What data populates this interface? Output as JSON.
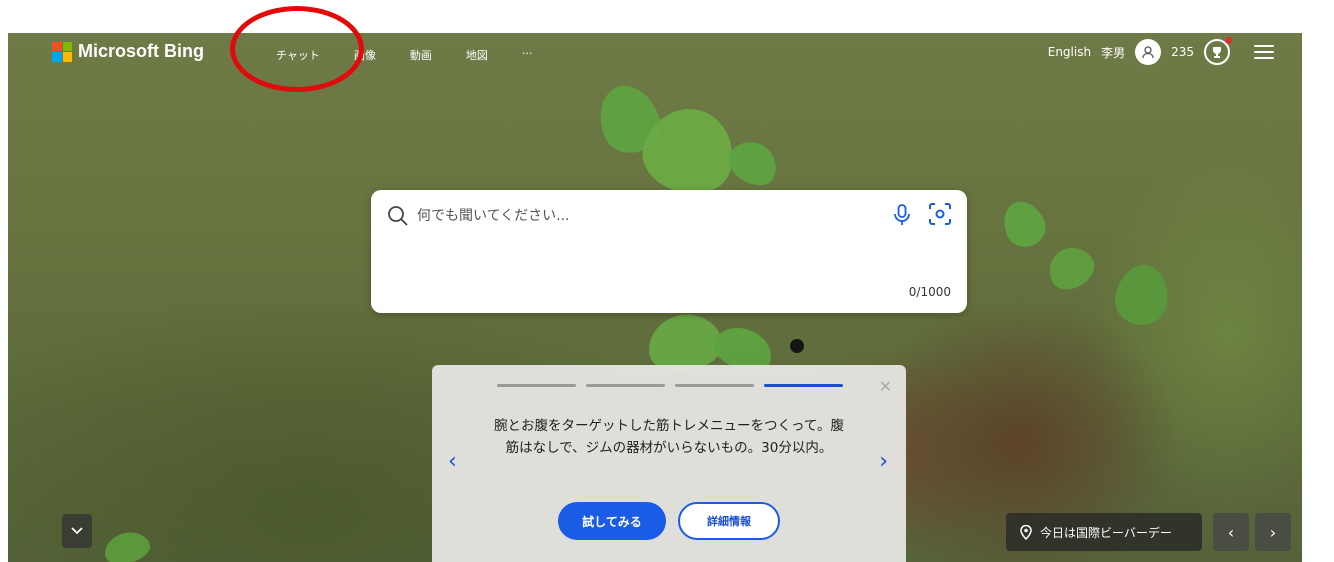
{
  "brand": {
    "name": "Microsoft Bing",
    "logo_colors": [
      "#f25022",
      "#7fba00",
      "#00a4ef",
      "#ffb900"
    ]
  },
  "nav": [
    {
      "label": "チャット"
    },
    {
      "label": "画像"
    },
    {
      "label": "動画"
    },
    {
      "label": "地図"
    },
    {
      "label": "···"
    }
  ],
  "header_right": {
    "language": "English",
    "username": "李男",
    "points": "235"
  },
  "search": {
    "placeholder": "何でも聞いてください...",
    "counter": "0/1000"
  },
  "card": {
    "message": "腕とお腹をターゲットした筋トレメニューをつくって。腹筋はなしで、ジムの器材がいらないもの。30分以内。",
    "try_label": "試してみる",
    "more_label": "詳細情報",
    "close_icon": "close-icon",
    "progress_steps": 4,
    "active_step": 4
  },
  "bottom": {
    "location_text": "今日は国際ビーバーデー"
  },
  "colors": {
    "accent": "#1b5ce6",
    "annotation": "#e10b0b"
  }
}
